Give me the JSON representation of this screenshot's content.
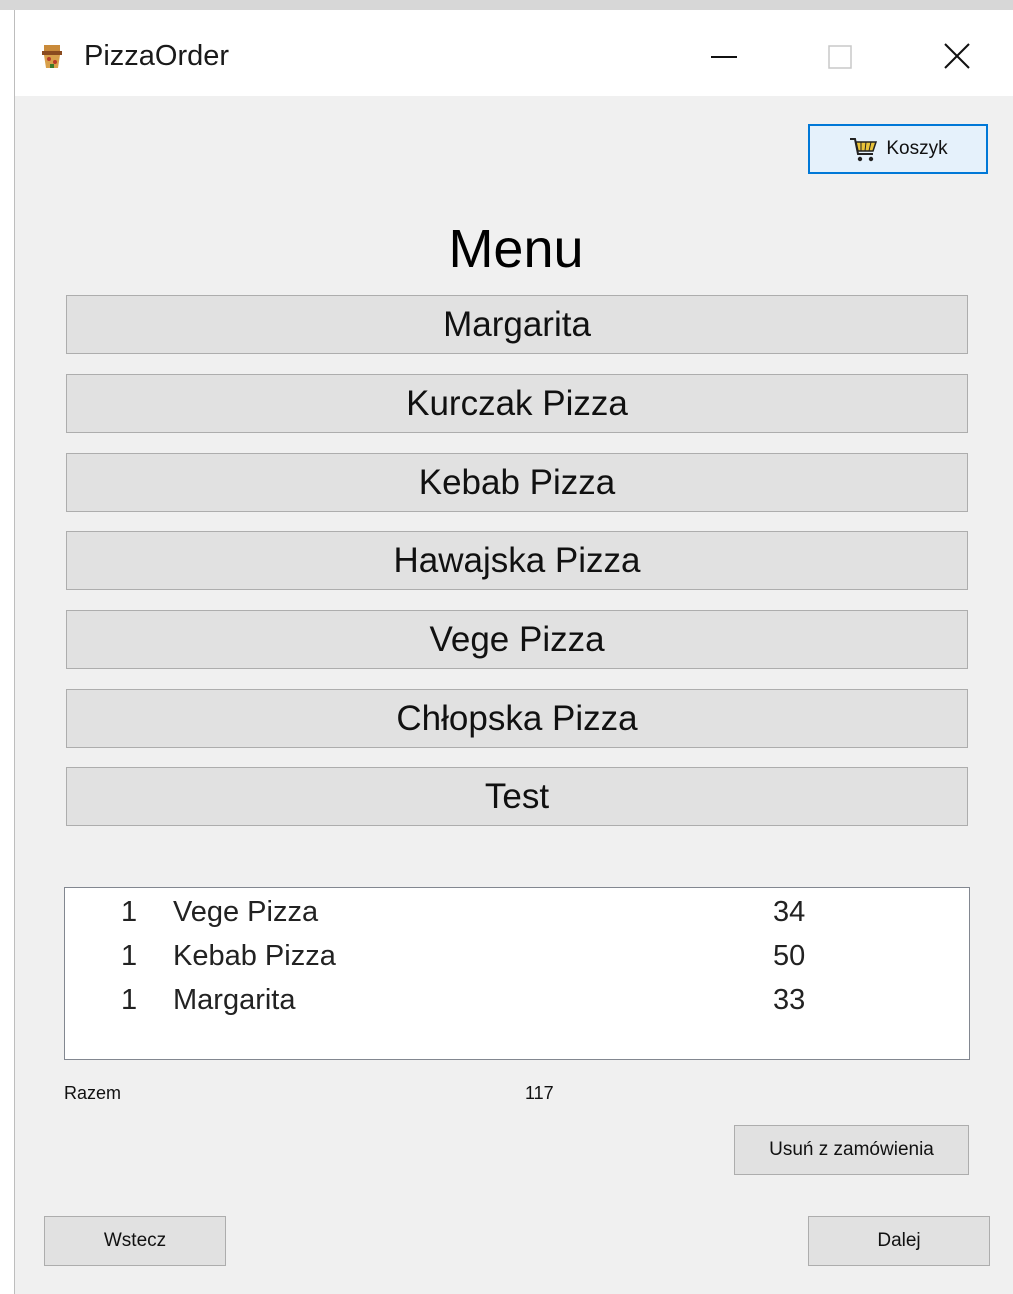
{
  "window": {
    "title": "PizzaOrder",
    "icon": "pizza-app-icon"
  },
  "toolbar": {
    "cart_label": "Koszyk",
    "cart_icon": "cart-icon"
  },
  "menu": {
    "heading": "Menu",
    "items": [
      {
        "label": "Margarita"
      },
      {
        "label": "Kurczak Pizza"
      },
      {
        "label": "Kebab Pizza"
      },
      {
        "label": "Hawajska Pizza"
      },
      {
        "label": "Vege Pizza"
      },
      {
        "label": "Chłopska Pizza"
      },
      {
        "label": "Test"
      }
    ]
  },
  "order": {
    "rows": [
      {
        "qty": "1",
        "name": "Vege Pizza",
        "price": "34"
      },
      {
        "qty": "1",
        "name": "Kebab Pizza",
        "price": "50"
      },
      {
        "qty": "1",
        "name": "Margarita",
        "price": "33"
      }
    ],
    "total_label": "Razem",
    "total_value": "117",
    "remove_label": "Usuń z zamówienia"
  },
  "nav": {
    "back_label": "Wstecz",
    "next_label": "Dalej"
  },
  "colors": {
    "window_bg": "#f0f0f0",
    "button_bg": "#e1e1e1",
    "accent": "#0078d7"
  }
}
